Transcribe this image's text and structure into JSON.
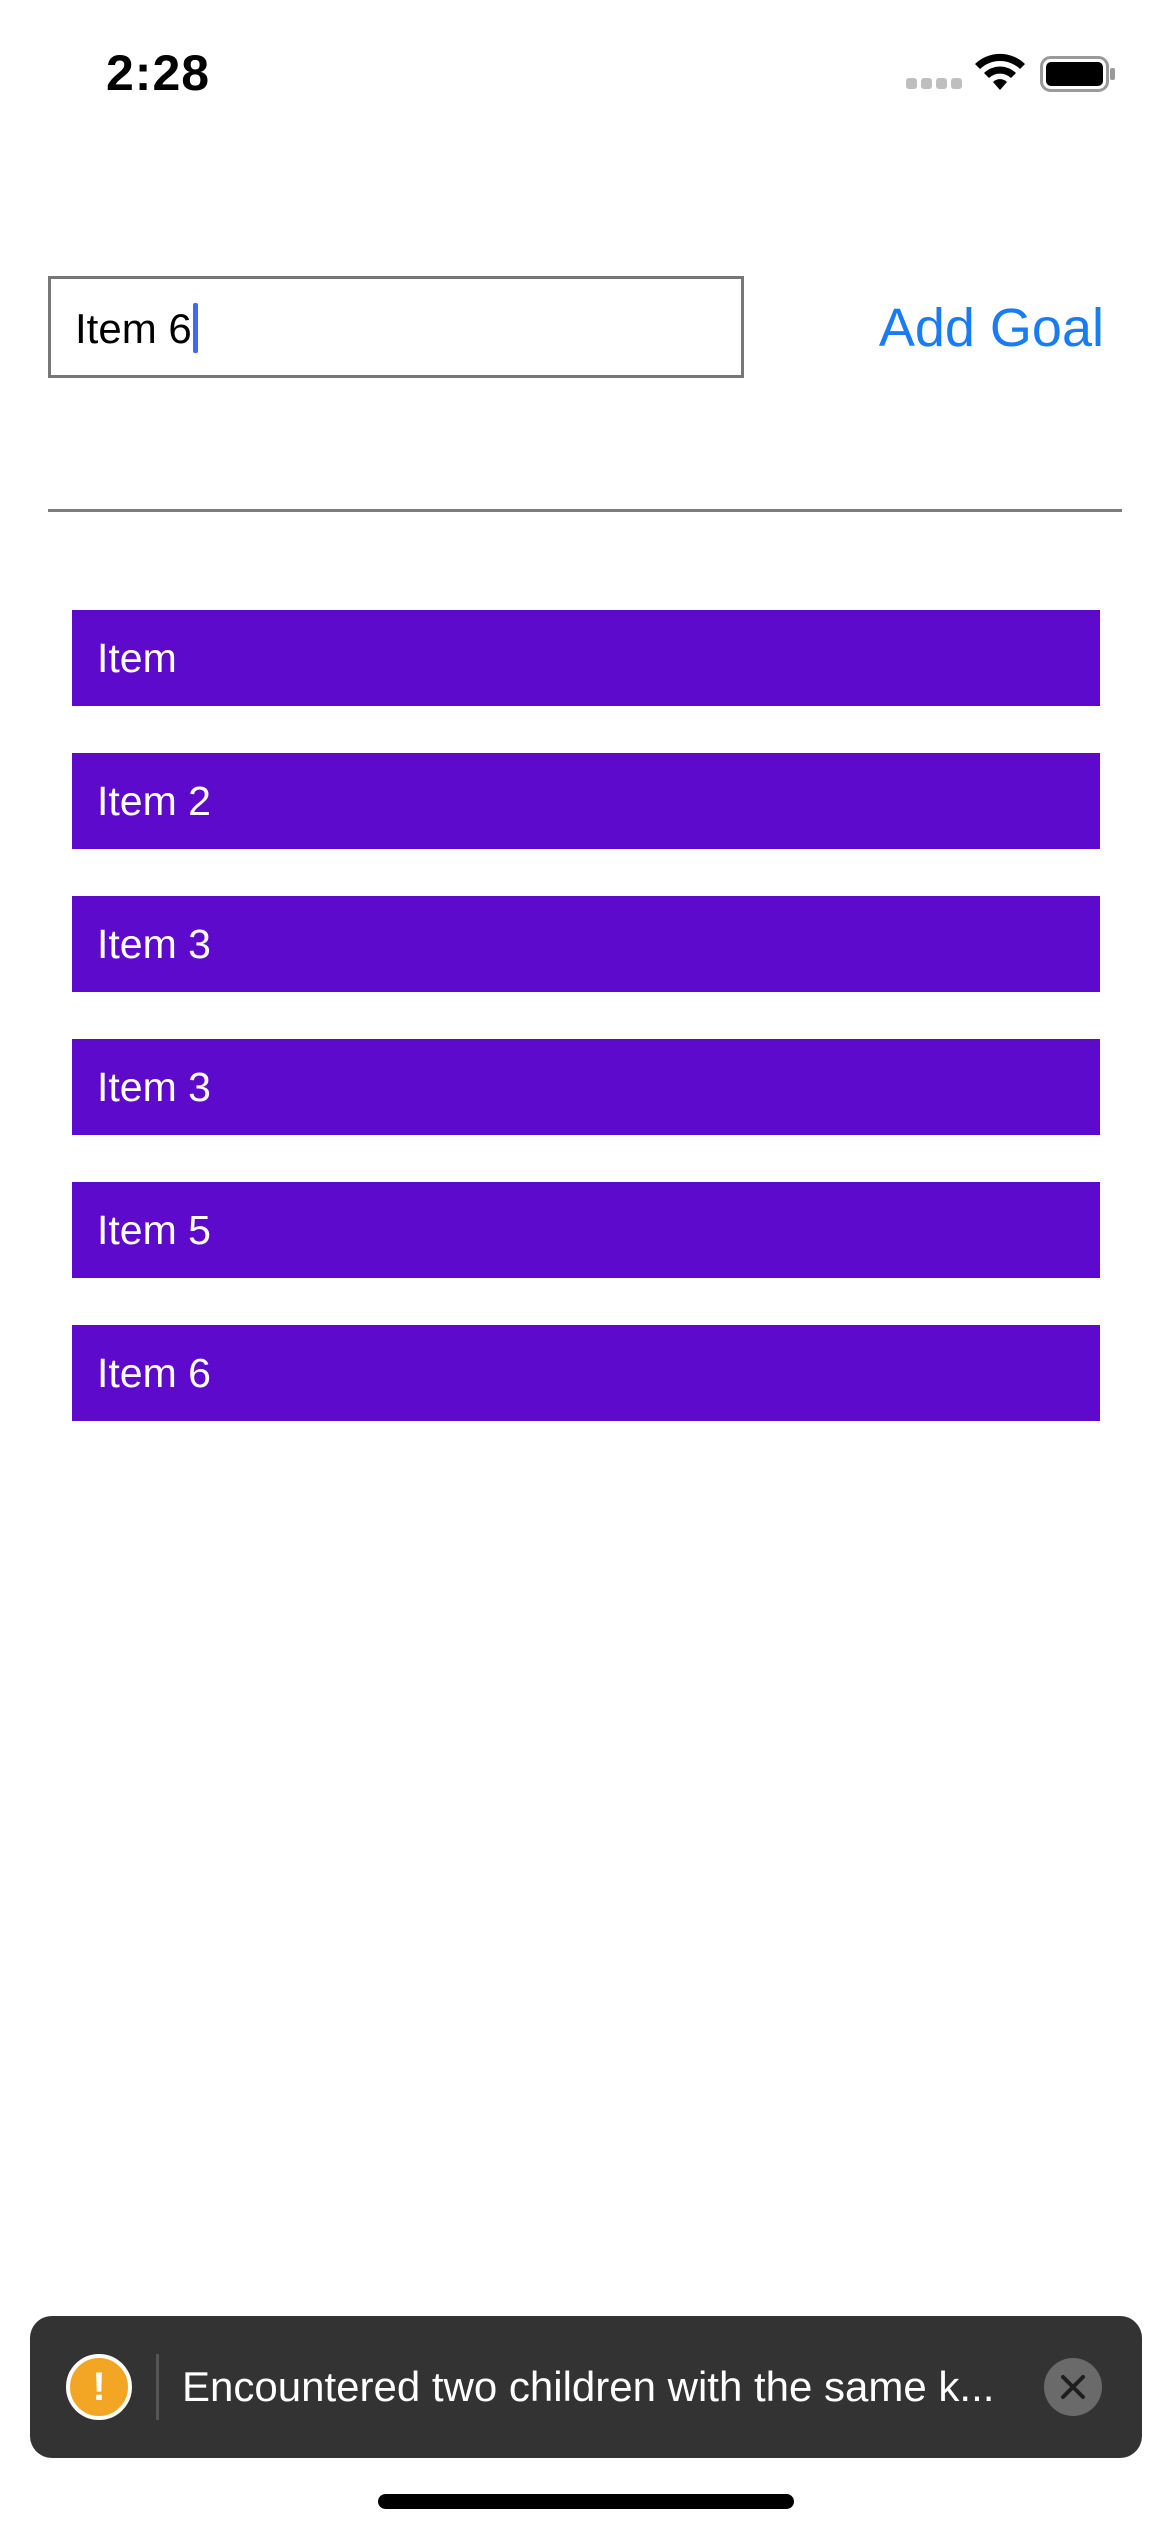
{
  "status_bar": {
    "time": "2:28",
    "icons": [
      "cellular-signal-icon",
      "wifi-icon",
      "battery-icon"
    ]
  },
  "goal_input": {
    "value": "Item 6",
    "placeholder": ""
  },
  "add_goal_button": {
    "label": "Add Goal"
  },
  "goals": [
    {
      "label": "Item"
    },
    {
      "label": "Item 2"
    },
    {
      "label": "Item 3"
    },
    {
      "label": "Item 3"
    },
    {
      "label": "Item 5"
    },
    {
      "label": "Item 6"
    }
  ],
  "toast": {
    "icon": "warning-icon",
    "message": "Encountered two children with the same k...",
    "close_icon": "close-icon"
  },
  "colors": {
    "accent": "#1a7cf2",
    "goal_item_bg": "#5e0acc",
    "toast_bg": "#333333",
    "warning": "#f2a623"
  }
}
